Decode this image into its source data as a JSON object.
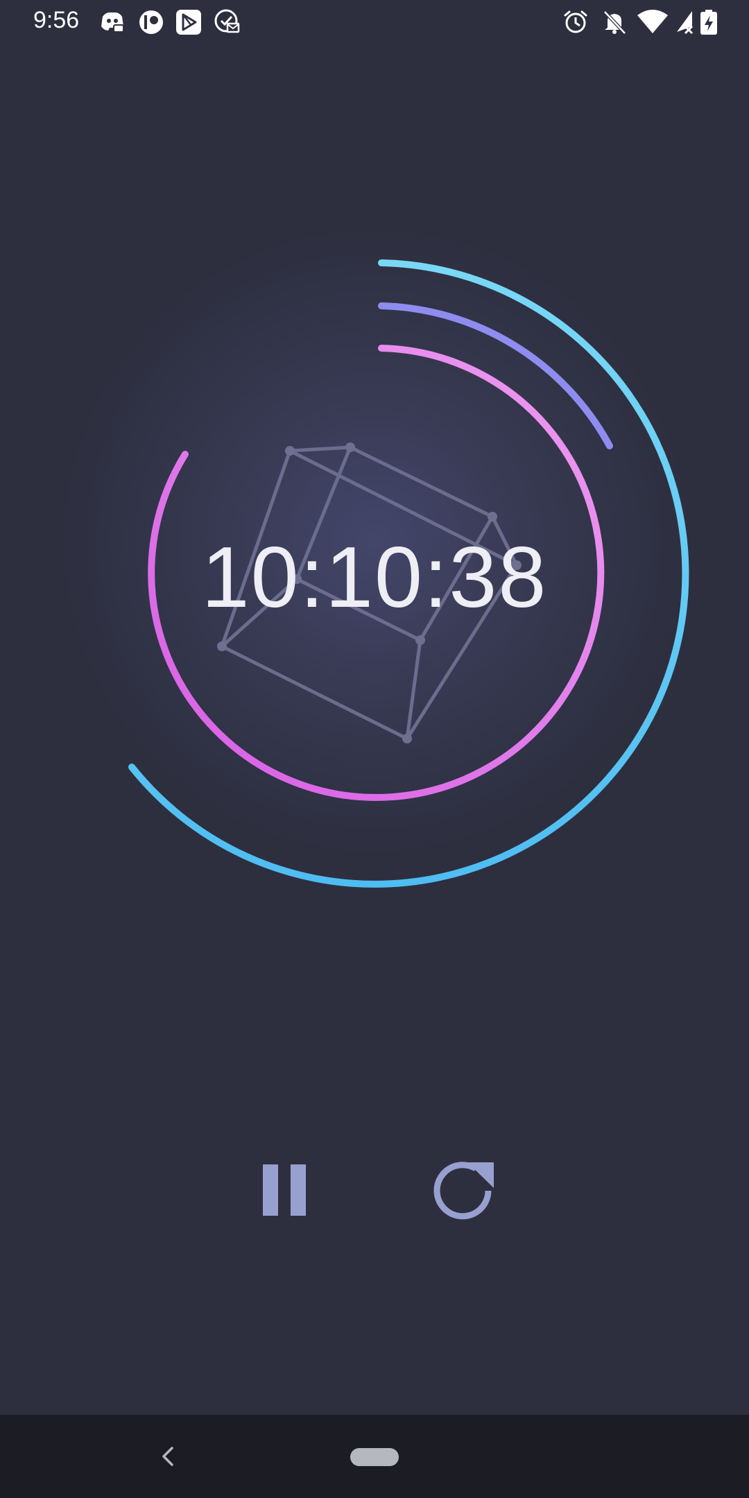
{
  "status_bar": {
    "time": "9:56",
    "left_icons": [
      "discord-icon",
      "patreon-icon",
      "play-store-icon",
      "mail-check-icon"
    ],
    "right_icons": [
      "alarm-icon",
      "notifications-off-icon",
      "wifi-icon",
      "signal-icon",
      "battery-charging-icon"
    ]
  },
  "stopwatch": {
    "time": "10:10:38",
    "ring_colors": {
      "outer": "#5cc8f5",
      "middle": "#8f8cf0",
      "inner": "#e277ec"
    }
  },
  "controls": {
    "pause_icon": "pause-icon",
    "reset_icon": "restart-icon",
    "icon_color": "#98a0d0"
  },
  "nav_bar": {
    "back_icon": "back-chevron-icon",
    "home_icon": "home-pill"
  }
}
